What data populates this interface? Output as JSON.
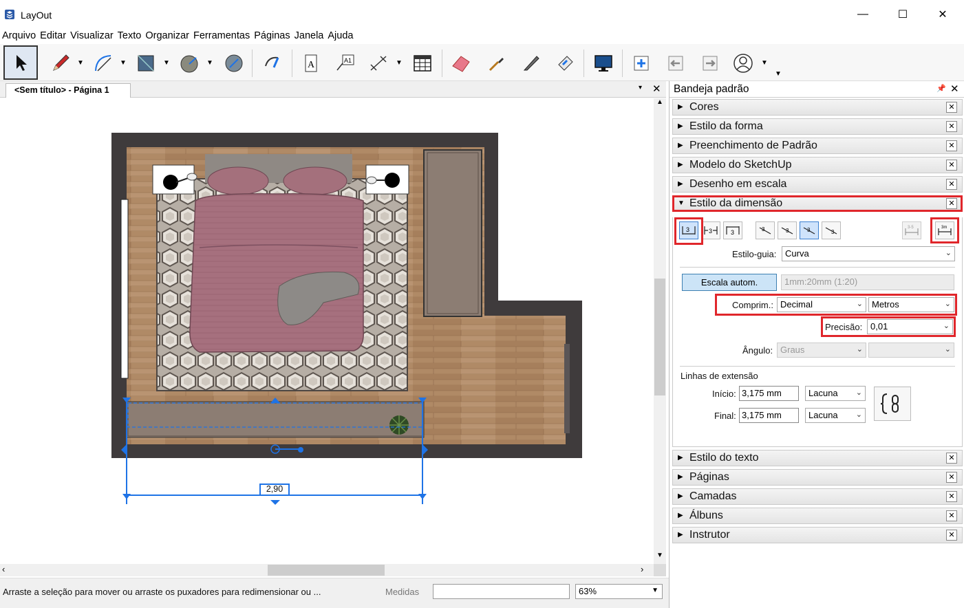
{
  "window": {
    "title": "LayOut",
    "minimize": "—",
    "maximize": "☐",
    "close": "✕"
  },
  "menu": [
    "Arquivo",
    "Editar",
    "Visualizar",
    "Texto",
    "Organizar",
    "Ferramentas",
    "Páginas",
    "Janela",
    "Ajuda"
  ],
  "document": {
    "tab_label": "<Sem título> - Página 1",
    "tab_menu": "▾",
    "tab_close": "✕"
  },
  "drawing": {
    "dimension_value": "2,90"
  },
  "status": {
    "message": "Arraste a seleção para mover ou arraste os puxadores para redimensionar ou ...",
    "measures_label": "Medidas",
    "measures_value": "",
    "zoom": "63%"
  },
  "tray": {
    "title": "Bandeja padrão",
    "pin": "🖈",
    "close": "✕",
    "panels_top": [
      "Cores",
      "Estilo da forma",
      "Preenchimento de Padrão",
      "Modelo do SketchUp",
      "Desenho em escala"
    ],
    "expanded_panel": "Estilo da dimensão",
    "panels_bottom": [
      "Estilo do texto",
      "Páginas",
      "Camadas",
      "Álbuns",
      "Instrutor"
    ],
    "dimension": {
      "guide_style_label": "Estilo-guia:",
      "guide_style_value": "Curva",
      "auto_scale_button": "Escala autom.",
      "scale_value": "1mm:20mm (1:20)",
      "length_label": "Comprim.:",
      "length_format": "Decimal",
      "length_unit": "Metros",
      "precision_label": "Precisão:",
      "precision_value": "0,01",
      "angle_label": "Ângulo:",
      "angle_unit": "Graus",
      "angle_precision": "",
      "extension_title": "Linhas de extensão",
      "start_label": "Início:",
      "start_value": "3,175 mm",
      "start_type": "Lacuna",
      "end_label": "Final:",
      "end_value": "3,175 mm",
      "end_type": "Lacuna",
      "text_buttons": [
        "⊢3⊣",
        "⊢3⊣",
        "⊢3⊣"
      ],
      "unit_button_top": "3m",
      "range_button_top": "3-5"
    }
  },
  "colors": {
    "highlight": "#e0262b",
    "selection": "#1e73e6",
    "wall": "#3f3b3c",
    "floor": "#b08a66",
    "rug": "#9b938c",
    "bed": "#a6707e",
    "wardrobe": "#8c7d73"
  }
}
